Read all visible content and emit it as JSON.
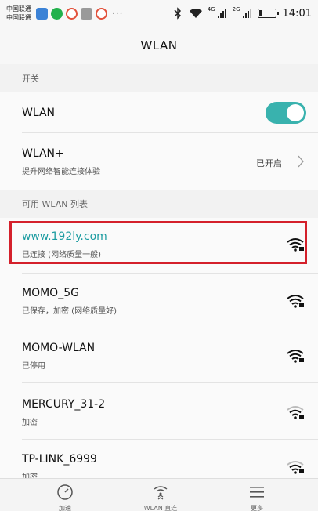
{
  "status_bar": {
    "carrier_line1": "中国联通",
    "carrier_line2": "中国联通",
    "more": "···",
    "net_4g": "4G",
    "net_2g": "2G",
    "time": "14:01"
  },
  "header": {
    "title": "WLAN"
  },
  "sections": {
    "switch": "开关",
    "available": "可用 WLAN 列表"
  },
  "wlan_toggle": {
    "label": "WLAN",
    "state": "on",
    "accent": "#39b2ae"
  },
  "wlan_plus": {
    "label": "WLAN+",
    "subtitle": "提升网络智能连接体验",
    "status": "已开启"
  },
  "networks": [
    {
      "name": "www.192ly.com",
      "status": "已连接 (网络质量一般)",
      "secured": true,
      "connected": true
    },
    {
      "name": "MOMO_5G",
      "status": "已保存，加密 (网络质量好)",
      "secured": true
    },
    {
      "name": "MOMO-WLAN",
      "status": "已停用",
      "secured": true
    },
    {
      "name": "MERCURY_31-2",
      "status": "加密",
      "secured": true
    },
    {
      "name": "TP-LINK_6999",
      "status": "加密",
      "secured": true
    }
  ],
  "highlight_color": "#d4202b",
  "bottom_bar": {
    "items": [
      {
        "icon": "speedometer-icon",
        "label": "加速"
      },
      {
        "icon": "wifi-direct-icon",
        "label": "WLAN 直连"
      },
      {
        "icon": "menu-icon",
        "label": "更多"
      }
    ]
  }
}
